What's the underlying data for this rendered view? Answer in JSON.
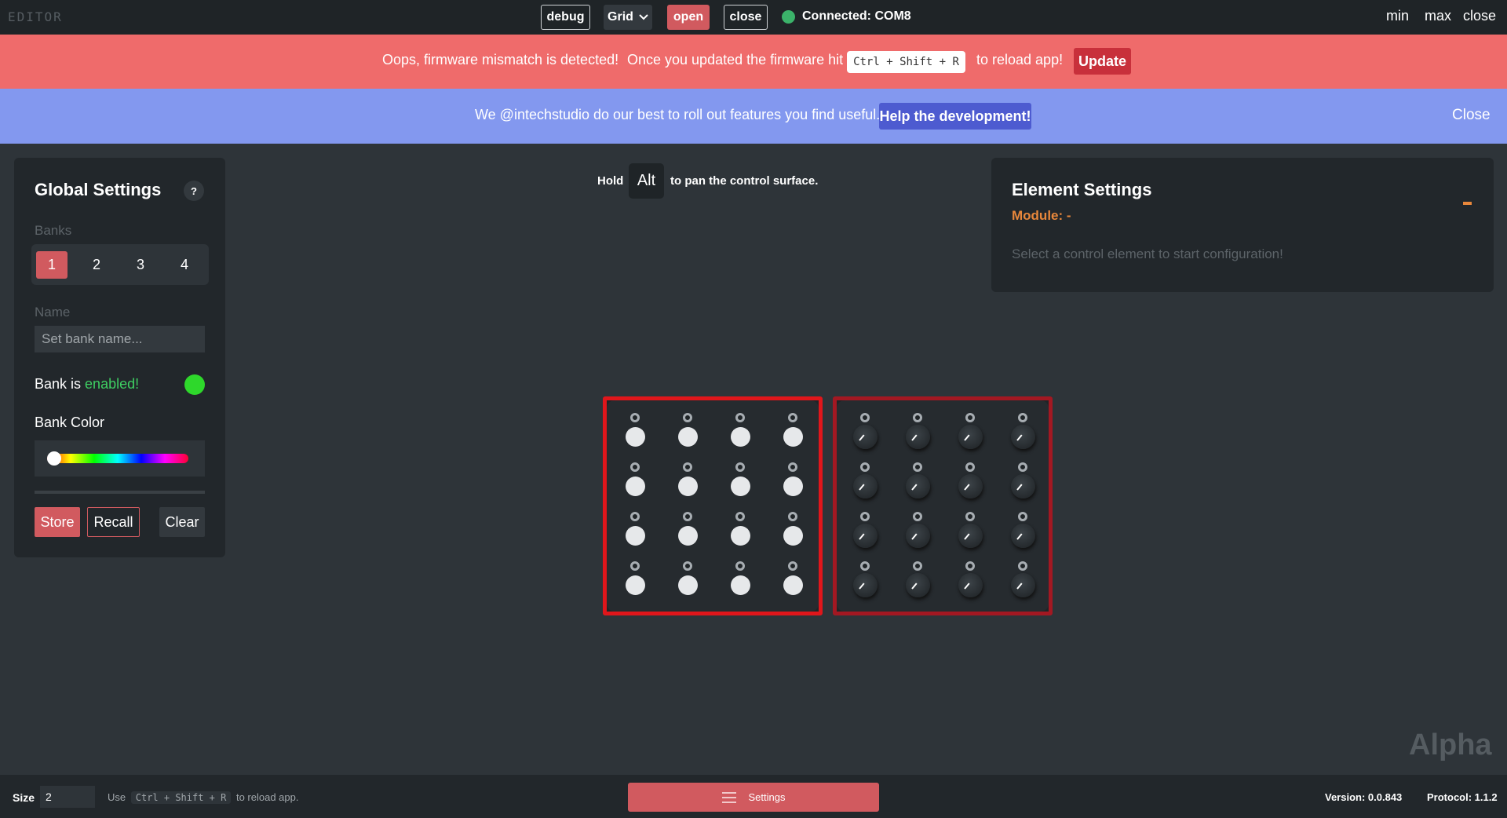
{
  "titlebar": {
    "app_title": "EDITOR",
    "debug_label": "debug",
    "grid_label": "Grid",
    "open_label": "open",
    "close_label": "close",
    "connection_status": "Connected: COM8",
    "window_min": "min",
    "window_max": "max",
    "window_close": "close"
  },
  "firmware_banner": {
    "message": "Oops, firmware mismatch is detected!",
    "instruction": "Once you updated the firmware hit",
    "shortcut": "Ctrl + Shift + R",
    "suffix": "to reload app!",
    "update_label": "Update"
  },
  "dev_banner": {
    "message": "We @intechstudio do our best to roll out features you find useful.",
    "help_label": "Help the development!",
    "close_label": "Close"
  },
  "global_settings": {
    "title": "Global Settings",
    "help_icon": "?",
    "banks_label": "Banks",
    "banks": [
      "1",
      "2",
      "3",
      "4"
    ],
    "active_bank": "1",
    "name_label": "Name",
    "name_placeholder": "Set bank name...",
    "bank_status_prefix": "Bank is",
    "bank_status_value": "enabled!",
    "bank_color_label": "Bank Color",
    "bank_color_position": 0,
    "store_label": "Store",
    "recall_label": "Recall",
    "clear_label": "Clear"
  },
  "pan_hint": {
    "prefix": "Hold",
    "key": "Alt",
    "suffix": "to pan the control surface."
  },
  "element_settings": {
    "title": "Element Settings",
    "module_label": "Module: -",
    "hint": "Select a control element to start configuration!"
  },
  "modules": [
    {
      "type": "buttons",
      "border_color": "#e0161b",
      "rows": 4,
      "cols": 4
    },
    {
      "type": "knobs",
      "border_color": "#a31822",
      "rows": 4,
      "cols": 4
    }
  ],
  "watermark": "Alpha",
  "footer": {
    "size_label": "Size",
    "size_value": "2",
    "hint_prefix": "Use",
    "hint_shortcut": "Ctrl + Shift + R",
    "hint_suffix": "to reload app.",
    "settings_label": "Settings",
    "version": "Version: 0.0.843",
    "protocol": "Protocol: 1.1.2"
  },
  "colors": {
    "accent": "#d15a5f",
    "background": "#2e3439",
    "panel": "#22272b",
    "firmware_banner": "#ef6b6b",
    "dev_banner": "#8398ef",
    "module_label": "#e8873b",
    "enabled": "#3ecf62"
  }
}
